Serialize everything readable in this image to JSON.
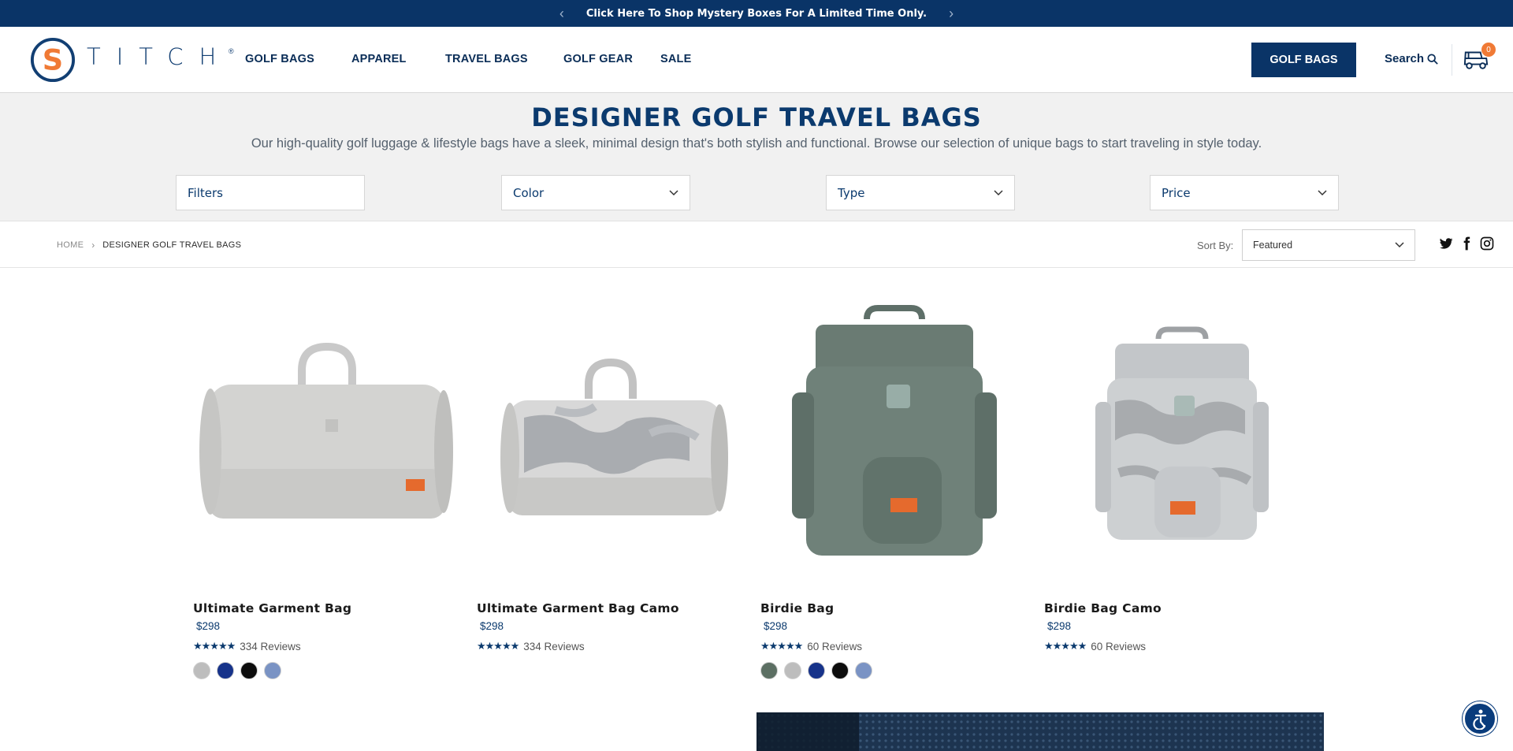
{
  "announcement": {
    "text": "Click Here To Shop Mystery Boxes For A Limited Time Only."
  },
  "header": {
    "logo_text": "TITCH",
    "logo_letter": "S",
    "logo_reg": "®",
    "nav": [
      "GOLF BAGS",
      "APPAREL",
      "TRAVEL BAGS",
      "GOLF GEAR",
      "SALE"
    ],
    "cta_label": "GOLF BAGS",
    "search_label": "Search",
    "cart_count": "0"
  },
  "hero": {
    "title": "DESIGNER GOLF TRAVEL BAGS",
    "subtitle": "Our high-quality golf luggage & lifestyle bags have a sleek, minimal design that's both stylish and functional. Browse our selection of unique bags to start traveling in style today.",
    "filters": [
      "Filters",
      "Color",
      "Type",
      "Price"
    ]
  },
  "breadcrumb": {
    "home": "HOME",
    "sep": "›",
    "current": "DESIGNER GOLF TRAVEL BAGS"
  },
  "sort": {
    "label": "Sort By:",
    "value": "Featured"
  },
  "products": [
    {
      "name": "Ultimate Garment Bag",
      "price": "$298",
      "reviews": "334 Reviews",
      "stars": "★★★★★",
      "swatches": [
        "#bdbdbd",
        "#17338a",
        "#0d0d0d",
        "#7a93c4"
      ]
    },
    {
      "name": "Ultimate Garment Bag Camo",
      "price": "$298",
      "reviews": "334 Reviews",
      "stars": "★★★★★",
      "swatches": []
    },
    {
      "name": "Birdie Bag",
      "price": "$298",
      "reviews": "60 Reviews",
      "stars": "★★★★★",
      "swatches": [
        "#5c6f63",
        "#bdbdbd",
        "#17338a",
        "#0d0d0d",
        "#7a93c4"
      ]
    },
    {
      "name": "Birdie Bag Camo",
      "price": "$298",
      "reviews": "60 Reviews",
      "stars": "★★★★★",
      "swatches": []
    }
  ],
  "colors": {
    "brand_navy": "#0a3467",
    "accent_orange": "#f07a35"
  }
}
